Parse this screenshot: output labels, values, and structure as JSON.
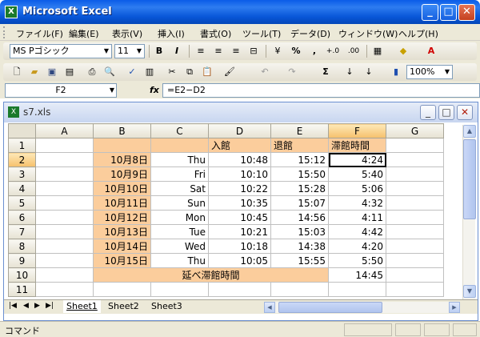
{
  "window": {
    "title": "Microsoft Excel"
  },
  "menu": [
    "ファイル(F)",
    "編集(E)",
    "表示(V)",
    "挿入(I)",
    "書式(O)",
    "ツール(T)",
    "データ(D)",
    "ウィンドウ(W)",
    "ヘルプ(H)"
  ],
  "format_toolbar": {
    "font": "MS Pゴシック",
    "size": "11",
    "bold": "B",
    "italic": "I",
    "percent": "%",
    "comma": ",",
    "inc_decimal": "+.0",
    "dec_decimal": ".00"
  },
  "standard_toolbar": {
    "zoom": "100%",
    "sum": "Σ"
  },
  "formula_bar": {
    "name_box": "F2",
    "fx": "fx",
    "formula": "=E2−D2"
  },
  "workbook": {
    "title": "s7.xls"
  },
  "columns": [
    "A",
    "B",
    "C",
    "D",
    "E",
    "F",
    "G"
  ],
  "rows": [
    "1",
    "2",
    "3",
    "4",
    "5",
    "6",
    "7",
    "8",
    "9",
    "10",
    "11"
  ],
  "headers": {
    "d": "入館",
    "e": "退館",
    "f": "滞館時間"
  },
  "data": [
    {
      "date": "10月8日",
      "day": "Thu",
      "in": "10:48",
      "out": "15:12",
      "stay": "4:24"
    },
    {
      "date": "10月9日",
      "day": "Fri",
      "in": "10:10",
      "out": "15:50",
      "stay": "5:40"
    },
    {
      "date": "10月10日",
      "day": "Sat",
      "in": "10:22",
      "out": "15:28",
      "stay": "5:06"
    },
    {
      "date": "10月11日",
      "day": "Sun",
      "in": "10:35",
      "out": "15:07",
      "stay": "4:32"
    },
    {
      "date": "10月12日",
      "day": "Mon",
      "in": "10:45",
      "out": "14:56",
      "stay": "4:11"
    },
    {
      "date": "10月13日",
      "day": "Tue",
      "in": "10:21",
      "out": "15:03",
      "stay": "4:42"
    },
    {
      "date": "10月14日",
      "day": "Wed",
      "in": "10:18",
      "out": "14:38",
      "stay": "4:20"
    },
    {
      "date": "10月15日",
      "day": "Thu",
      "in": "10:05",
      "out": "15:55",
      "stay": "5:50"
    }
  ],
  "total": {
    "label": "延べ滞館時間",
    "value": "14:45"
  },
  "sheets": [
    "Sheet1",
    "Sheet2",
    "Sheet3"
  ],
  "status": {
    "text": "コマンド"
  },
  "colors": {
    "title_bar": "#0a5ce8",
    "header_fill": "#fbcd9c",
    "selected_header": "#f6c06b"
  }
}
